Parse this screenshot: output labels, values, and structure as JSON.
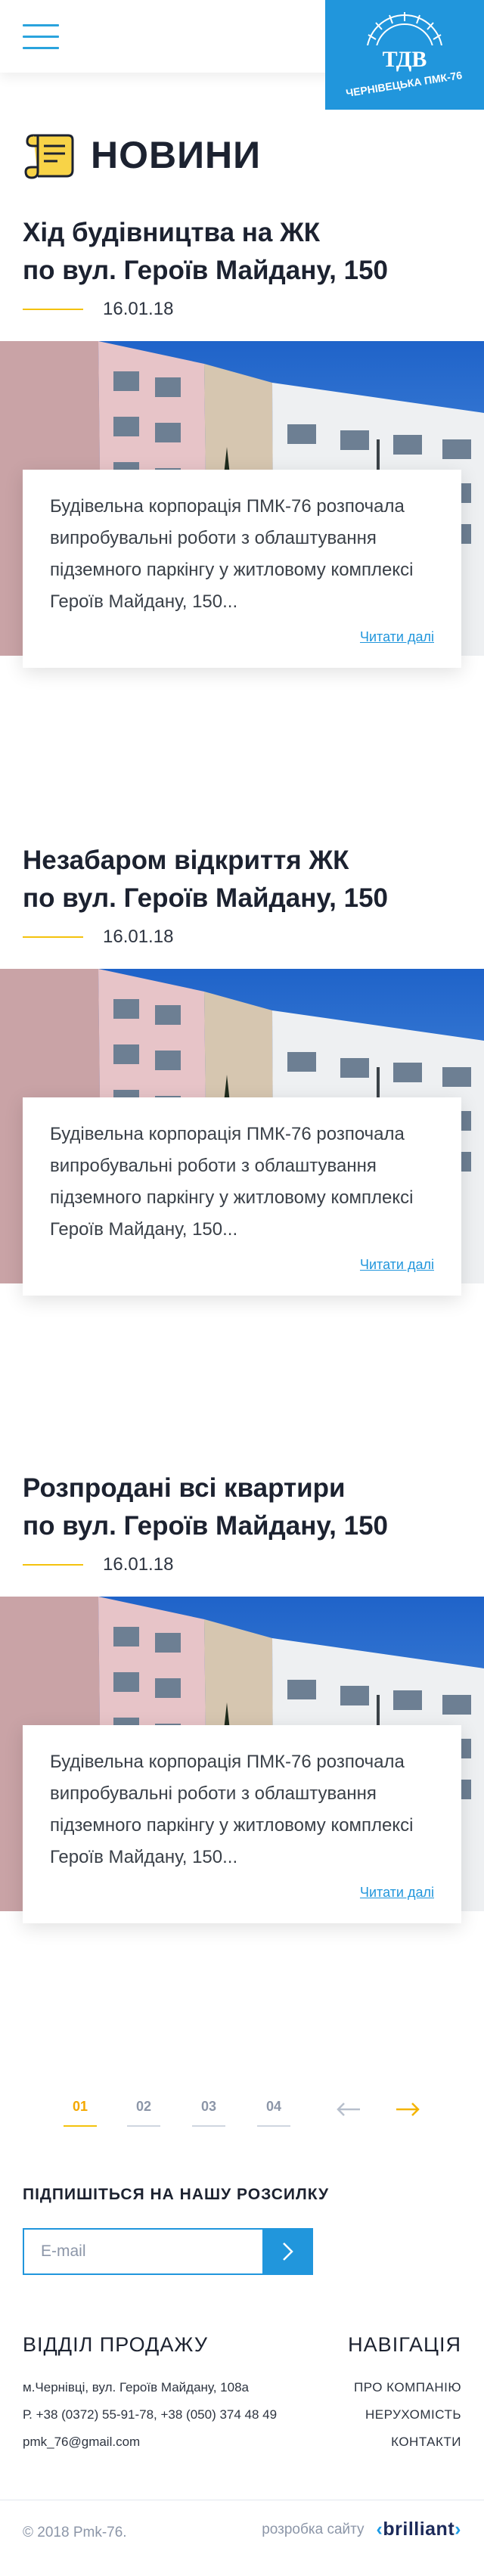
{
  "header": {
    "logo": {
      "top_text": "ТДВ",
      "bottom_text": "ЧЕРНІВЕЦЬКА ПМК-76"
    }
  },
  "page": {
    "title": "НОВИНИ"
  },
  "news": [
    {
      "title_line1": "Хід будівництва на ЖК",
      "title_line2": "по вул. Героїв Майдану, 150",
      "date": "16.01.18",
      "excerpt_line1": "Будівельна корпорація ПМК-76 розпочала",
      "excerpt_line2": "випробувальні роботи з облаштування",
      "excerpt_line3": "підземного паркінгу у житловому комплексі",
      "excerpt_line4": "Героїв Майдану, 150...",
      "more": "Читати далі"
    },
    {
      "title_line1": "Незабаром відкриття ЖК",
      "title_line2": "по вул. Героїв Майдану, 150",
      "date": "16.01.18",
      "excerpt_line1": "Будівельна корпорація ПМК-76 розпочала",
      "excerpt_line2": "випробувальні роботи з облаштування",
      "excerpt_line3": "підземного паркінгу у житловому комплексі",
      "excerpt_line4": "Героїв Майдану, 150...",
      "more": "Читати далі"
    },
    {
      "title_line1": "Розпродані всі квартири",
      "title_line2": "по вул. Героїв Майдану, 150",
      "date": "16.01.18",
      "excerpt_line1": "Будівельна корпорація ПМК-76 розпочала",
      "excerpt_line2": "випробувальні роботи з облаштування",
      "excerpt_line3": "підземного паркінгу у житловому комплексі",
      "excerpt_line4": "Героїв Майдану, 150...",
      "more": "Читати далі"
    }
  ],
  "pagination": {
    "pages": [
      "01",
      "02",
      "03",
      "04"
    ],
    "active": "01"
  },
  "subscribe": {
    "title": "ПІДПИШІТЬСЯ НА НАШУ РОЗСИЛКУ",
    "placeholder": "E-mail"
  },
  "footer": {
    "sales_title": "ВІДДІЛ ПРОДАЖУ",
    "address": "м.Чернівці, вул. Героїв Майдану, 108а",
    "phones": "Р. +38 (0372) 55-91-78, +38 (050) 374 48 49",
    "email": "pmk_76@gmail.com",
    "nav_title": "НАВІГАЦІЯ",
    "nav_links": [
      "ПРО КОМПАНІЮ",
      "НЕРУХОМІСТЬ",
      "КОНТАКТИ"
    ],
    "copyright": "© 2018 Pmk-76.",
    "dev_label": "розробка сайту",
    "dev_brand": "brilliant"
  },
  "colors": {
    "accent": "#2196dc",
    "highlight": "#f4c20d",
    "text": "#1c2230"
  }
}
